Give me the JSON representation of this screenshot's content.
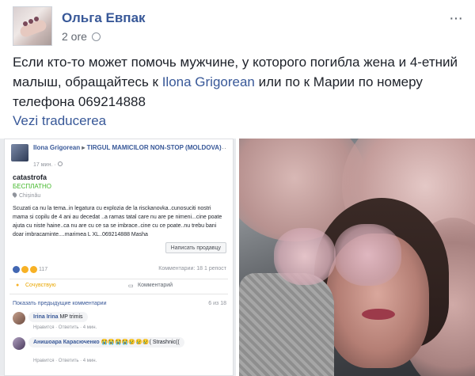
{
  "post": {
    "author": "Ольга Евпак",
    "time": "2 ore",
    "more": "···",
    "text_before": "Если кто-то может помочь мужчине, у которого погибла жена и 4-етний малыш, обращайтесь к ",
    "mention": "Ilona Grigorean",
    "text_after": " или по к Марии по номеру телефона 069214888",
    "translate_link": "Vezi traducerea"
  },
  "embedded_post": {
    "author": "Ilona Grigorean",
    "arrow": "▸",
    "group": "TIRGUL MAMICILOR NON-STOP (MOLDOVA)",
    "time": "17 мин. · ",
    "item_title": "catastrofa",
    "price": "БЕСПЛАТНО",
    "location": "Chișinău",
    "body": "Scuzati ca nu la tema..in legatura cu explozia de la risckanovka..cunosuciti nostri mama si copilu de 4 ani au decedat ..a ramas tatal care nu are pe nimeni...cine poate ajuta cu niste haine..ca nu are cu ce sa se imbrace..cine cu ce poate..nu trebu bani doar imbracaminte....marimea L XL..069214888 Masha",
    "message_button": "Написать продавцу",
    "reactions_count": "117",
    "comments_stats": "Комментарии: 18  1 репост",
    "action_like": "Сочувствую",
    "action_comment": "Комментарий",
    "show_previous": "Показать предыдущие комментарии",
    "comment_counter": "6 из 18",
    "comments": [
      {
        "name": "Irina Irina",
        "text": "MP trimis",
        "meta": "Нравится · Ответить · 4 мин."
      },
      {
        "name": "Анишоара Карасюченко",
        "text": "😭😭😭😭😢😢😢( Strashnic((",
        "meta": "Нравится · Ответить · 4 мин."
      }
    ]
  },
  "colors": {
    "link": "#385898",
    "text": "#1d2129",
    "meta": "#616770",
    "price_green": "#42b72a"
  }
}
